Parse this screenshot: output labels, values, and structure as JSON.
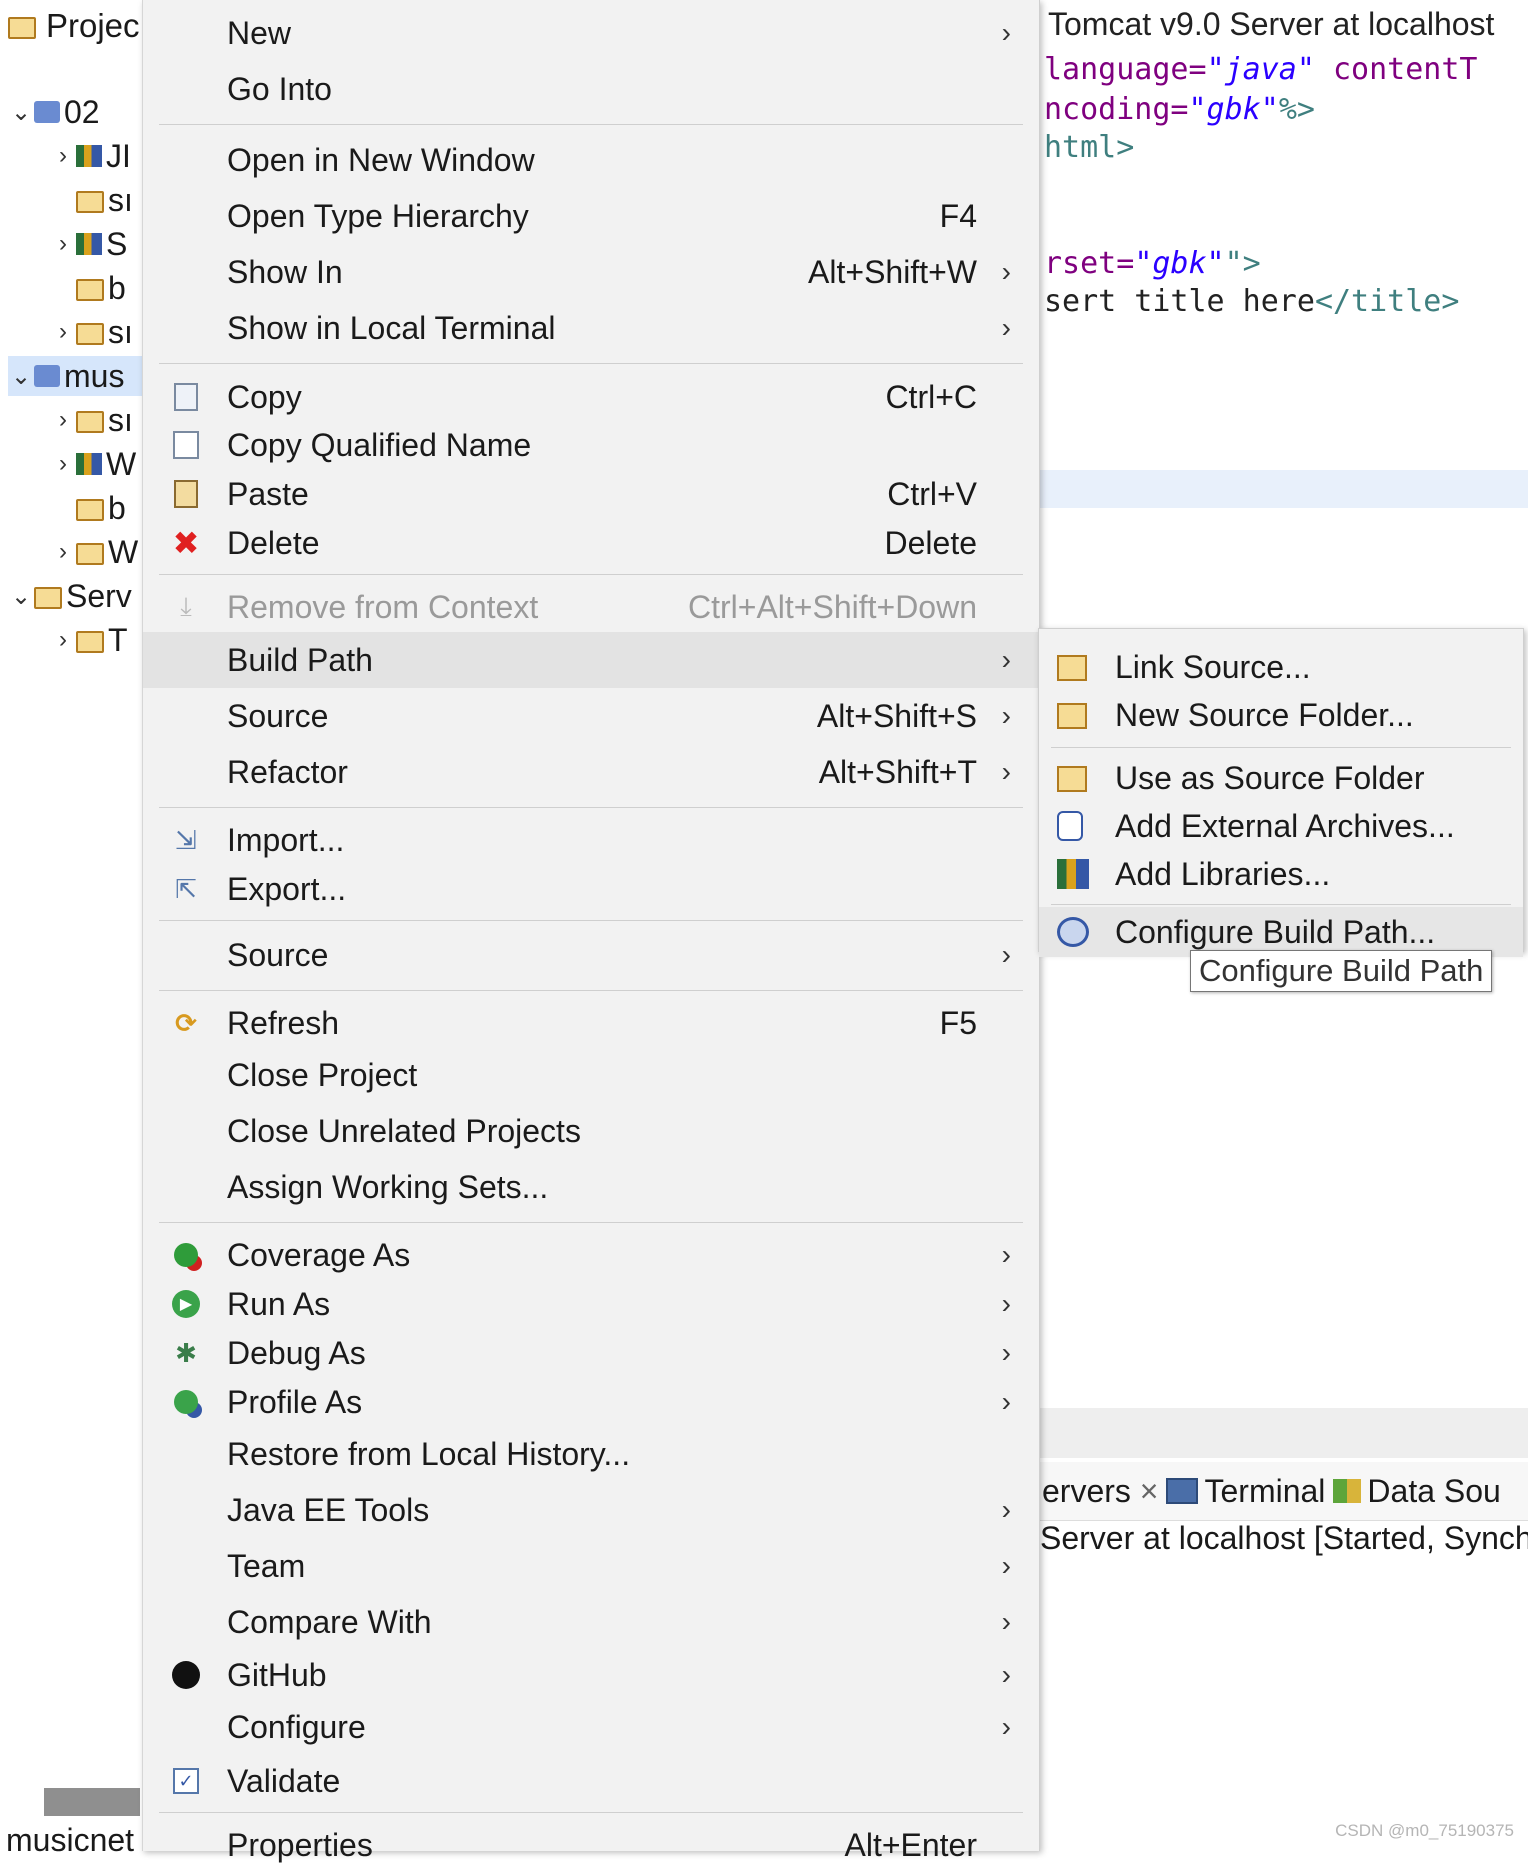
{
  "explorer": {
    "title": "Projec",
    "rows": [
      {
        "label": "02",
        "expanded": true
      },
      {
        "label": "JI"
      },
      {
        "label": "sı"
      },
      {
        "label": "S"
      },
      {
        "label": "b"
      },
      {
        "label": "sı"
      },
      {
        "label": "mus",
        "expanded": true
      },
      {
        "label": "sı"
      },
      {
        "label": "W"
      },
      {
        "label": "b"
      },
      {
        "label": "W"
      },
      {
        "label": "Serv",
        "expanded": true
      },
      {
        "label": "T"
      }
    ],
    "bottom_text": "musicnet"
  },
  "editor": {
    "title": "Tomcat v9.0 Server at localhost",
    "code_lines": [
      {
        "a": "language=",
        "b": "\"java\"",
        "c": " contentT"
      },
      {
        "a": "ncoding=",
        "b": "\"gbk\"",
        "c": "%>"
      },
      {
        "a": "",
        "b": "",
        "c": " html>"
      },
      {
        "a": "rset=",
        "b": "\"gbk\"",
        "c": "\">"
      },
      {
        "a": "sert title here",
        "b": "",
        "c": "</title>"
      }
    ],
    "tabs": [
      "ervers",
      "Terminal",
      "Data Sou"
    ],
    "tab_close": "×",
    "server_status": "Server at localhost  [Started, Synch"
  },
  "menu": {
    "items": [
      {
        "label": "New",
        "shortcut": "",
        "arrow": true,
        "icon": ""
      },
      {
        "label": "Go Into",
        "shortcut": "",
        "arrow": false,
        "icon": ""
      },
      {
        "label": "Open in New Window",
        "shortcut": "",
        "arrow": false,
        "icon": ""
      },
      {
        "label": "Open Type Hierarchy",
        "shortcut": "F4",
        "arrow": false,
        "icon": ""
      },
      {
        "label": "Show In",
        "shortcut": "Alt+Shift+W",
        "arrow": true,
        "icon": ""
      },
      {
        "label": "Show in Local Terminal",
        "shortcut": "",
        "arrow": true,
        "icon": ""
      },
      {
        "label": "Copy",
        "shortcut": "Ctrl+C",
        "arrow": false,
        "icon": "copy-icon"
      },
      {
        "label": "Copy Qualified Name",
        "shortcut": "",
        "arrow": false,
        "icon": "copy-qualified-icon"
      },
      {
        "label": "Paste",
        "shortcut": "Ctrl+V",
        "arrow": false,
        "icon": "paste-icon"
      },
      {
        "label": "Delete",
        "shortcut": "Delete",
        "arrow": false,
        "icon": "delete-icon"
      },
      {
        "label": "Remove from Context",
        "shortcut": "Ctrl+Alt+Shift+Down",
        "arrow": false,
        "icon": "remove-context-icon",
        "disabled": true
      },
      {
        "label": "Build Path",
        "shortcut": "",
        "arrow": true,
        "icon": "",
        "active": true
      },
      {
        "label": "Source",
        "shortcut": "Alt+Shift+S",
        "arrow": true,
        "icon": ""
      },
      {
        "label": "Refactor",
        "shortcut": "Alt+Shift+T",
        "arrow": true,
        "icon": ""
      },
      {
        "label": "Import...",
        "shortcut": "",
        "arrow": false,
        "icon": "import-icon"
      },
      {
        "label": "Export...",
        "shortcut": "",
        "arrow": false,
        "icon": "export-icon"
      },
      {
        "label": "Source",
        "shortcut": "",
        "arrow": true,
        "icon": ""
      },
      {
        "label": "Refresh",
        "shortcut": "F5",
        "arrow": false,
        "icon": "refresh-icon"
      },
      {
        "label": "Close Project",
        "shortcut": "",
        "arrow": false,
        "icon": ""
      },
      {
        "label": "Close Unrelated Projects",
        "shortcut": "",
        "arrow": false,
        "icon": ""
      },
      {
        "label": "Assign Working Sets...",
        "shortcut": "",
        "arrow": false,
        "icon": ""
      },
      {
        "label": "Coverage As",
        "shortcut": "",
        "arrow": true,
        "icon": "coverage-icon"
      },
      {
        "label": "Run As",
        "shortcut": "",
        "arrow": true,
        "icon": "run-icon"
      },
      {
        "label": "Debug As",
        "shortcut": "",
        "arrow": true,
        "icon": "debug-icon"
      },
      {
        "label": "Profile As",
        "shortcut": "",
        "arrow": true,
        "icon": "profile-icon"
      },
      {
        "label": "Restore from Local History...",
        "shortcut": "",
        "arrow": false,
        "icon": ""
      },
      {
        "label": "Java EE Tools",
        "shortcut": "",
        "arrow": true,
        "icon": ""
      },
      {
        "label": "Team",
        "shortcut": "",
        "arrow": true,
        "icon": ""
      },
      {
        "label": "Compare With",
        "shortcut": "",
        "arrow": true,
        "icon": ""
      },
      {
        "label": "GitHub",
        "shortcut": "",
        "arrow": true,
        "icon": "github-icon"
      },
      {
        "label": "Configure",
        "shortcut": "",
        "arrow": true,
        "icon": ""
      },
      {
        "label": "Validate",
        "shortcut": "",
        "arrow": false,
        "icon": "validate-icon"
      },
      {
        "label": "Properties",
        "shortcut": "Alt+Enter",
        "arrow": false,
        "icon": ""
      }
    ]
  },
  "submenu": {
    "items": [
      {
        "label": "Link Source...",
        "icon": "link-source-icon"
      },
      {
        "label": "New Source Folder...",
        "icon": "new-source-folder-icon"
      },
      {
        "label": "Use as Source Folder",
        "icon": "use-source-folder-icon"
      },
      {
        "label": "Add External Archives...",
        "icon": "external-archive-icon"
      },
      {
        "label": "Add Libraries...",
        "icon": "libraries-icon"
      },
      {
        "label": "Configure Build Path...",
        "icon": "configure-build-path-icon",
        "active": true
      }
    ]
  },
  "tooltip": "Configure Build Path",
  "watermark": "CSDN @m0_75190375",
  "colors": {
    "menu_bg": "#f2f2f2",
    "active_bg": "#e3e3e3",
    "keyword": "#7f007f",
    "string": "#2a00ff",
    "tag": "#3f7f7f",
    "delete_red": "#e02020"
  }
}
